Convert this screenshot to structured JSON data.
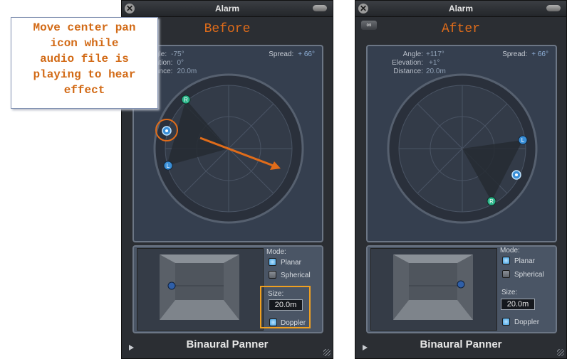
{
  "callout": {
    "text": "Move center pan\nicon  while\naudio file is\nplaying to hear\neffect"
  },
  "before": {
    "window_title": "Alarm",
    "heading": "Before",
    "angle_label": "gle:",
    "angle_value": "-75°",
    "elevation_label": "ation:",
    "elevation_value": "0°",
    "distance_label": "ance:",
    "distance_value": "20.0m",
    "spread_label": "Spread:",
    "spread_value": "+ 66°",
    "mode_label": "Mode:",
    "planar_label": "Planar",
    "spherical_label": "Spherical",
    "size_label": "Size:",
    "size_value": "20.0m",
    "doppler_label": "Doppler",
    "footer": "Binaural Panner",
    "right_marker": "R",
    "left_marker": "L"
  },
  "after": {
    "window_title": "Alarm",
    "heading": "After",
    "angle_label": "Angle:",
    "angle_value": "+117°",
    "elevation_label": "Elevation:",
    "elevation_value": "+1°",
    "distance_label": "Distance:",
    "distance_value": "20.0m",
    "spread_label": "Spread:",
    "spread_value": "+ 66°",
    "mode_label": "Mode:",
    "planar_label": "Planar",
    "spherical_label": "Spherical",
    "size_label": "Size:",
    "size_value": "20.0m",
    "doppler_label": "Doppler",
    "footer": "Binaural Panner",
    "right_marker": "R",
    "left_marker": "L"
  },
  "icons": {
    "close": "close-icon",
    "zoom": "zoom-button",
    "link": "link-icon",
    "play": "play-triangle-icon",
    "resize": "resize-grip-icon"
  },
  "colors": {
    "accent_orange": "#e06c1a",
    "highlight": "#f0a020",
    "panel_bg": "#353f4f",
    "window_bg": "#2b2e33",
    "marker_green": "#2bb58a",
    "marker_blue": "#3a8fd8"
  }
}
